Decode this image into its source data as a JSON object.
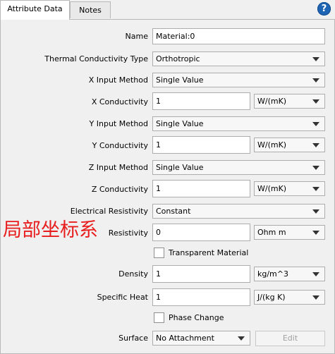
{
  "tabs": [
    "Attribute Data",
    "Notes"
  ],
  "help_icon": "?",
  "name": {
    "label": "Name",
    "value": "Material:0"
  },
  "thermal_type": {
    "label": "Thermal Conductivity Type",
    "value": "Orthotropic"
  },
  "x_method": {
    "label": "X Input Method",
    "value": "Single Value"
  },
  "x_cond": {
    "label": "X Conductivity",
    "value": "1",
    "unit": "W/(mK)"
  },
  "y_method": {
    "label": "Y Input Method",
    "value": "Single Value"
  },
  "y_cond": {
    "label": "Y Conductivity",
    "value": "1",
    "unit": "W/(mK)"
  },
  "z_method": {
    "label": "Z Input Method",
    "value": "Single Value"
  },
  "z_cond": {
    "label": "Z Conductivity",
    "value": "1",
    "unit": "W/(mK)"
  },
  "elec": {
    "label": "Electrical Resistivity",
    "value": "Constant"
  },
  "resistivity": {
    "label": "Resistivity",
    "value": "0",
    "unit": "Ohm m"
  },
  "transparent": {
    "label": "Transparent Material"
  },
  "density": {
    "label": "Density",
    "value": "1",
    "unit": "kg/m^3"
  },
  "specific_heat": {
    "label": "Specific Heat",
    "value": "1",
    "unit": "J/(kg K)"
  },
  "phase": {
    "label": "Phase Change"
  },
  "surface": {
    "label": "Surface",
    "value": "No Attachment",
    "edit": "Edit"
  },
  "overlay_text": "局部坐标系",
  "colors": {
    "overlay": "#e81e1e",
    "help": "#1e64b4"
  }
}
